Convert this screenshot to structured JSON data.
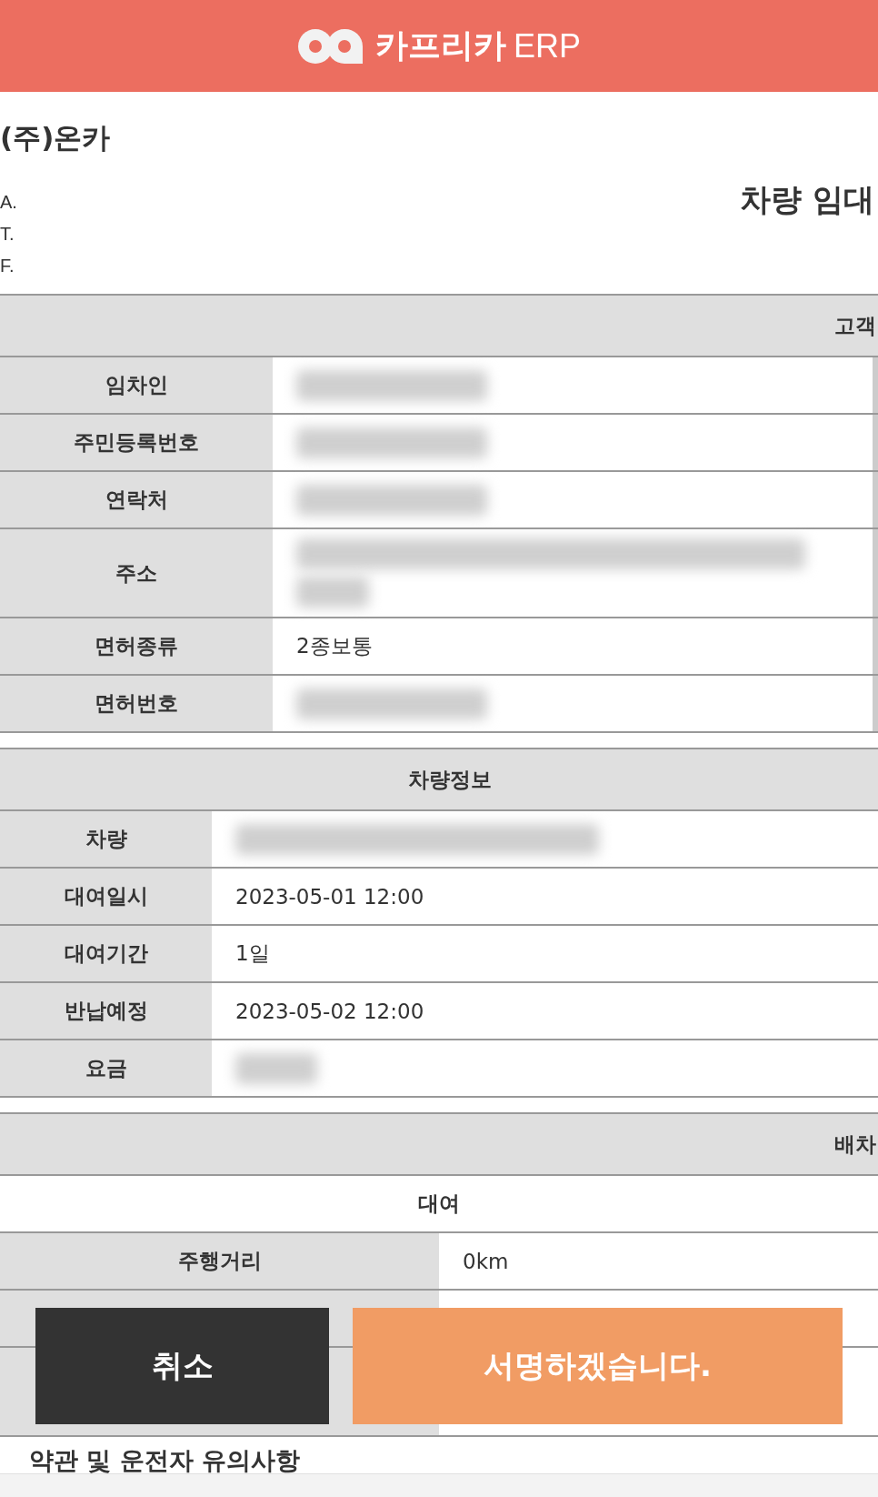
{
  "header": {
    "brand": "카프리카",
    "suffix": "ERP"
  },
  "company": {
    "name": "(주)온카",
    "lines": [
      "A.",
      "T.",
      "F."
    ]
  },
  "doc_title": "차량 임대",
  "customer": {
    "title": "고객",
    "rows": [
      {
        "label": "임차인",
        "kind": "redacted"
      },
      {
        "label": "주민등록번호",
        "kind": "redacted"
      },
      {
        "label": "연락처",
        "kind": "redacted"
      },
      {
        "label": "주소",
        "kind": "redacted_tall"
      },
      {
        "label": "면허종류",
        "kind": "text",
        "value": "2종보통"
      },
      {
        "label": "면허번호",
        "kind": "redacted"
      }
    ]
  },
  "vehicle": {
    "title": "차량정보",
    "rows": [
      {
        "label": "차량",
        "kind": "redacted"
      },
      {
        "label": "대여일시",
        "kind": "text",
        "value": "2023-05-01 12:00"
      },
      {
        "label": "대여기간",
        "kind": "text",
        "value": "1일"
      },
      {
        "label": "반납예정",
        "kind": "text",
        "value": "2023-05-02 12:00"
      },
      {
        "label": "요금",
        "kind": "redacted_short"
      }
    ]
  },
  "dispatch": {
    "title": "배차",
    "subtitle": "대여",
    "rows": [
      {
        "label": "주행거리",
        "kind": "text",
        "value": "0km"
      },
      {
        "kind": "covered"
      },
      {
        "kind": "covered_tall"
      }
    ]
  },
  "terms_heading": "약관 및 운전자 유의사항",
  "buttons": [
    {
      "label": "취소",
      "kind": "cancel"
    },
    {
      "label": "서명하겠습니다.",
      "kind": "primary"
    }
  ]
}
